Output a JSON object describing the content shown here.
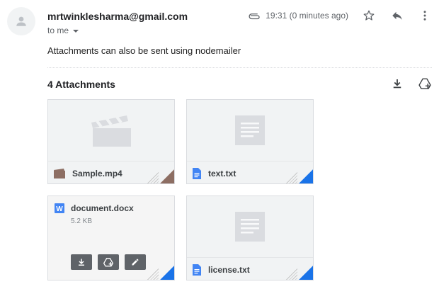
{
  "email": {
    "sender": "mrtwinklesharma@gmail.com",
    "recipient_label": "to me",
    "time": "19:31 (0 minutes ago)",
    "body": "Attachments can also be sent using nodemailer"
  },
  "attachments": {
    "title": "4 Attachments",
    "items": [
      {
        "name": "Sample.mp4",
        "type": "video",
        "icon": "video-icon",
        "icon_color": "#8d6e63",
        "corner_color": "#8d6e63"
      },
      {
        "name": "text.txt",
        "type": "text",
        "icon": "doc-icon",
        "icon_color": "#4285f4",
        "corner_color": "#1a73e8"
      },
      {
        "name": "document.docx",
        "size": "5.2 KB",
        "type": "word",
        "icon": "word-icon",
        "icon_color": "#4285f4",
        "corner_color": "#1a73e8"
      },
      {
        "name": "license.txt",
        "type": "text",
        "icon": "doc-icon",
        "icon_color": "#4285f4",
        "corner_color": "#1a73e8"
      }
    ]
  },
  "colors": {
    "accent_blue": "#1a73e8",
    "video_brown": "#8d6e63",
    "dark_button": "#5f6368"
  }
}
